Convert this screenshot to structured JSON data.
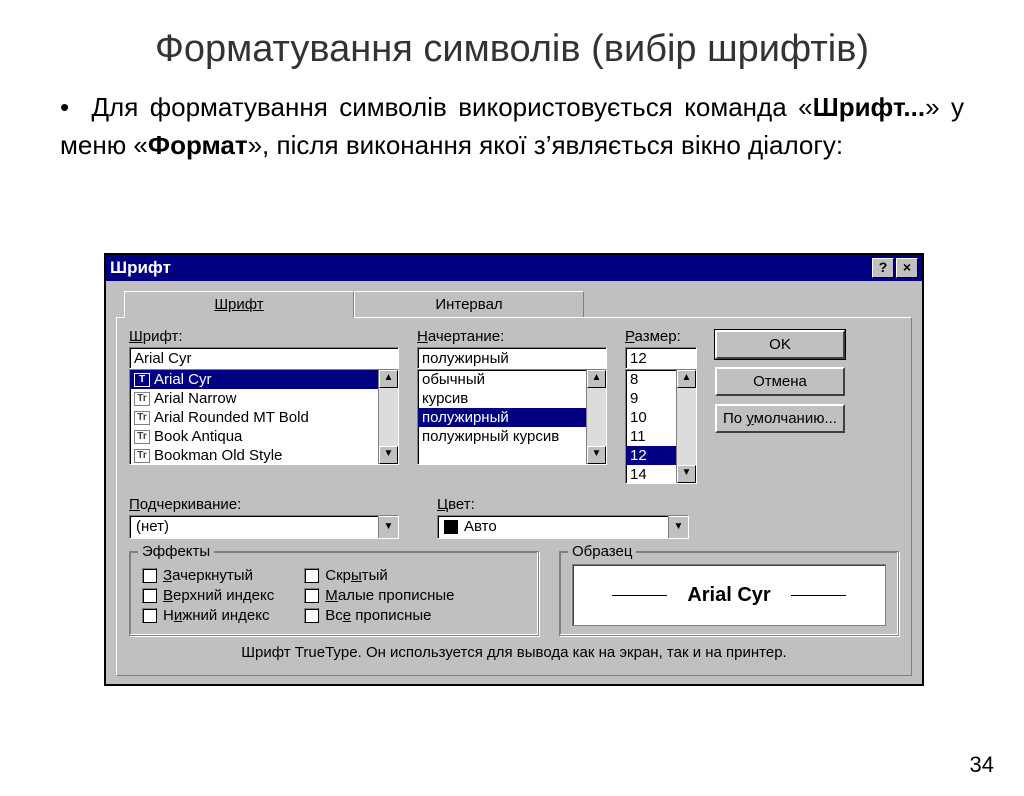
{
  "slide": {
    "title": "Форматування символів (вибір шрифтів)",
    "body_prefix": "Для форматування символів використовується команда «",
    "body_bold1": "Шрифт...",
    "body_mid": "» у меню «",
    "body_bold2": "Формат",
    "body_suffix": "», після виконання якої з’являється вікно діалогу:",
    "page_number": "34"
  },
  "dialog": {
    "title": "Шрифт",
    "help_btn": "?",
    "close_btn": "×",
    "tabs": {
      "font": "Шрифт",
      "spacing": "Интервал"
    },
    "labels": {
      "font": "Шрифт:",
      "font_u": "Ш",
      "style": "Начертание:",
      "style_u": "Н",
      "size": "Размер:",
      "size_u": "Р",
      "underline": "Подчеркивание:",
      "underline_u": "П",
      "color": "Цвет:",
      "color_u": "Ц",
      "effects": "Эффекты",
      "sample": "Образец"
    },
    "font": {
      "value": "Arial Cyr",
      "items": [
        "Arial Cyr",
        "Arial Narrow",
        "Arial Rounded MT Bold",
        "Book Antiqua",
        "Bookman Old Style"
      ],
      "selected_index": 0
    },
    "style": {
      "value": "полужирный",
      "items": [
        "обычный",
        "курсив",
        "полужирный",
        "полужирный курсив"
      ],
      "selected_index": 2
    },
    "size": {
      "value": "12",
      "items": [
        "8",
        "9",
        "10",
        "11",
        "12",
        "14"
      ],
      "selected_index": 4
    },
    "underline": {
      "value": "(нет)"
    },
    "color": {
      "value": "Авто"
    },
    "effects": {
      "strike": "Зачеркнутый",
      "strike_u": "З",
      "super": "Верхний индекс",
      "super_u": "В",
      "sub": "Нижний индекс",
      "sub_u": "и",
      "hidden": "Скрытый",
      "hidden_u": "ы",
      "smallcaps": "Малые прописные",
      "smallcaps_u": "М",
      "allcaps": "Все прописные",
      "allcaps_u": "е"
    },
    "sample_text": "Arial Cyr",
    "buttons": {
      "ok": "OK",
      "cancel": "Отмена",
      "default": "По умолчанию...",
      "default_u": "у"
    },
    "status": "Шрифт TrueType. Он используется для вывода как на экран, так и на принтер."
  }
}
